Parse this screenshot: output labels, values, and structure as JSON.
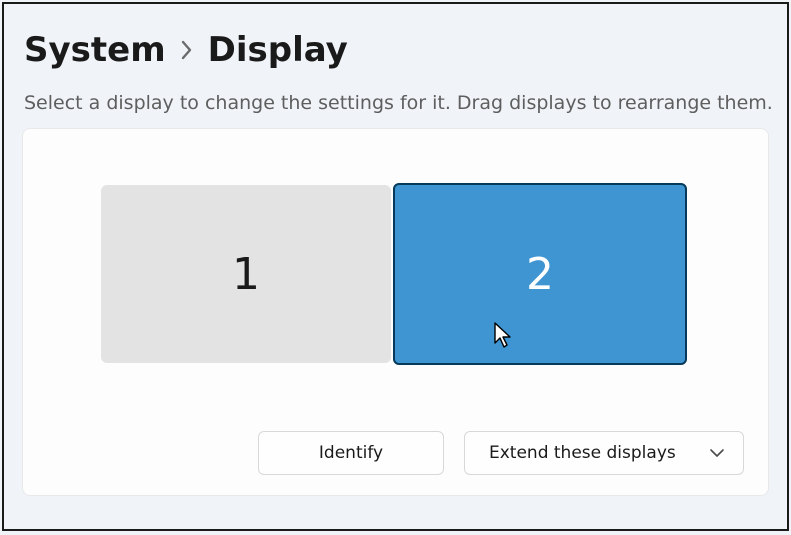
{
  "breadcrumb": {
    "parent": "System",
    "current": "Display"
  },
  "helper_text": "Select a display to change the settings for it. Drag displays to rearrange them.",
  "displays": [
    {
      "number": "1",
      "selected": false
    },
    {
      "number": "2",
      "selected": true
    }
  ],
  "actions": {
    "identify_label": "Identify",
    "mode_selected": "Extend these displays"
  }
}
